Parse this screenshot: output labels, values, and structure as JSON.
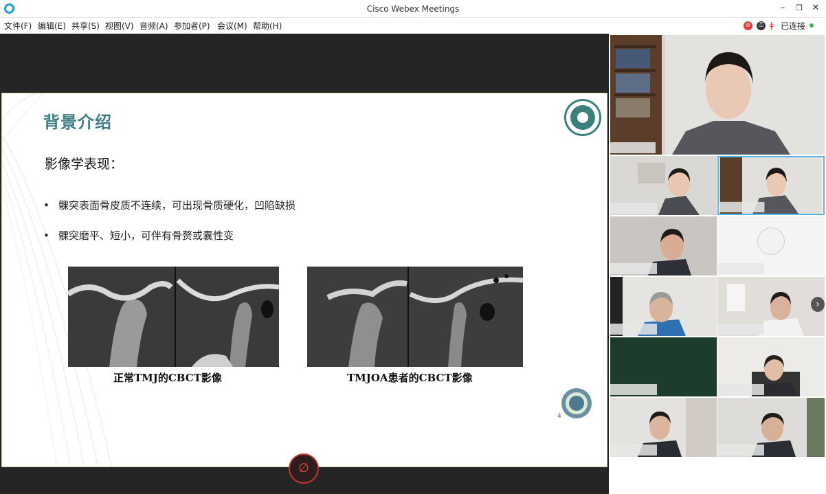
{
  "window": {
    "title": "Cisco Webex Meetings"
  },
  "menu": {
    "items": [
      "文件(F)",
      "编辑(E)",
      "共享(S)",
      "视图(V)",
      "音频(A)",
      "参加者(P)",
      "会议(M)",
      "帮助(H)"
    ]
  },
  "status": {
    "connected_label": "已连接"
  },
  "slide": {
    "title": "背景介绍",
    "subtitle": "影像学表现：",
    "bullets": [
      "髁突表面骨皮质不连续，可出现骨质硬化，凹陷缺损",
      "髁突磨平、短小，可伴有骨赘或囊性变"
    ],
    "captions": [
      "正常TMJ的CBCT影像",
      "TMJOA患者的CBCT影像"
    ],
    "page_number": "4"
  },
  "icons": {
    "app": "webex-logo-icon",
    "minimize": "minimize-icon",
    "maximize": "restore-icon",
    "close": "close-icon",
    "record": "recording-icon",
    "lock": "lock-icon",
    "mic": "mic-muted-icon",
    "mute": "mute-microphone-icon",
    "next": "chevron-right-icon"
  },
  "colors": {
    "accent": "#1aa1d8",
    "slide_title": "#3f7f85",
    "connected": "#2eb84b",
    "mute": "#e74c3c"
  }
}
